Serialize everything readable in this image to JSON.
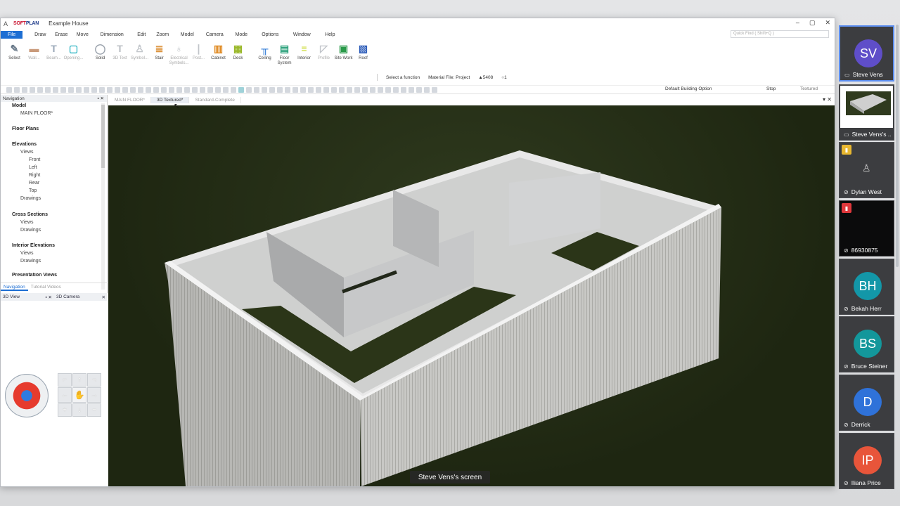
{
  "window": {
    "app_icon": "A",
    "brand_soft": "SOFT",
    "brand_plan": "PLAN",
    "title": "Example House",
    "controls": [
      "–",
      "▢",
      "✕"
    ]
  },
  "menu": {
    "file": "File",
    "items": [
      "Draw",
      "Erase",
      "Move",
      "Dimension",
      "Edit",
      "Zoom",
      "Model",
      "Camera",
      "Mode",
      "Options",
      "Window",
      "Help"
    ],
    "quick_find": "Quick Find ( Shift+Q )"
  },
  "ribbon": [
    {
      "label": "Select",
      "icon": "✎",
      "color": "#6a7a8a",
      "dim": false
    },
    {
      "label": "Wall...",
      "icon": "▬",
      "color": "#c99a7a",
      "dim": true
    },
    {
      "label": "Beam...",
      "icon": "T",
      "color": "#9aa8b8",
      "dim": true
    },
    {
      "label": "Opening...",
      "icon": "▢",
      "color": "#39b8c6",
      "dim": true
    },
    {
      "label": "Solid",
      "icon": "◯",
      "color": "#9ba3ad",
      "dim": false
    },
    {
      "label": "3D Text",
      "icon": "T",
      "color": "#b8bcc2",
      "dim": true
    },
    {
      "label": "Symbol...",
      "icon": "♙",
      "color": "#c0c4c9",
      "dim": true
    },
    {
      "label": "Stair",
      "icon": "≣",
      "color": "#d9892a",
      "dim": false
    },
    {
      "label": "Electrical Symbols...",
      "icon": "♁",
      "color": "#c0c4c9",
      "dim": true
    },
    {
      "label": "Post...",
      "icon": "❘",
      "color": "#c0c4c9",
      "dim": true
    },
    {
      "label": "Cabinet",
      "icon": "▥",
      "color": "#e08a22",
      "dim": false
    },
    {
      "label": "Deck",
      "icon": "▦",
      "color": "#9ab82a",
      "dim": false
    },
    {
      "label": "Ceiling",
      "icon": "╥",
      "color": "#1d6ed3",
      "dim": false
    },
    {
      "label": "Floor System",
      "icon": "▤",
      "color": "#2aa07a",
      "dim": false
    },
    {
      "label": "Interior",
      "icon": "≡",
      "color": "#c8d82a",
      "dim": false
    },
    {
      "label": "Profile",
      "icon": "◸",
      "color": "#c0c4c9",
      "dim": true
    },
    {
      "label": "Site Work",
      "icon": "▣",
      "color": "#2a9a4a",
      "dim": false
    },
    {
      "label": "Roof",
      "icon": "▧",
      "color": "#2a5ab8",
      "dim": false
    }
  ],
  "cmdbar": {
    "select_function": "Select a function",
    "material_file": "Material File: Project",
    "count": "▲5408",
    "zero": "○1"
  },
  "toolstrip": {
    "building_option": "Default Building Option",
    "stop": "Stop",
    "textured": "Textured"
  },
  "nav": {
    "title": "Navigation",
    "tree": [
      "Model",
      "MAIN FLOOR*",
      "Floor Plans",
      "Elevations",
      "Views",
      "Front",
      "Left",
      "Right",
      "Rear",
      "Top",
      "Drawings",
      "Cross Sections",
      "Views",
      "Drawings",
      "Interior Elevations",
      "Views",
      "Drawings",
      "Presentation Views"
    ],
    "tabs": [
      "Navigation",
      "Tutorial Videos"
    ]
  },
  "subpanels": [
    "3D View",
    "3D Camera"
  ],
  "dpad": [
    "⌐",
    "↑",
    "¬",
    "←",
    "✋",
    "→",
    "+",
    "↓",
    "−"
  ],
  "doc_tabs": [
    "MAIN FLOOR*",
    "3D Textured*",
    "Standard-Complete"
  ],
  "caption": "Steve Vens's screen",
  "participants": [
    {
      "initials": "SV",
      "name": "Steve Vens",
      "color": "#5f4ec9",
      "type": "avatar",
      "active": true
    },
    {
      "initials": "",
      "name": "Steve Vens's ...",
      "color": "#ffffff",
      "type": "screen",
      "active": false
    },
    {
      "initials": "",
      "name": "Dylan West",
      "color": "#3c3d40",
      "type": "icon",
      "active": false
    },
    {
      "initials": "",
      "name": "86930875",
      "color": "#111111",
      "type": "blank",
      "active": false
    },
    {
      "initials": "BH",
      "name": "Bekah Herr",
      "color": "#1397a8",
      "type": "avatar",
      "active": false
    },
    {
      "initials": "BS",
      "name": "Bruce Steiner",
      "color": "#13979b",
      "type": "avatar",
      "active": false
    },
    {
      "initials": "D",
      "name": "Derrick",
      "color": "#2f72d9",
      "type": "avatar",
      "active": false
    },
    {
      "initials": "IP",
      "name": "Iliana Price",
      "color": "#e8553a",
      "type": "avatar",
      "active": false
    }
  ]
}
